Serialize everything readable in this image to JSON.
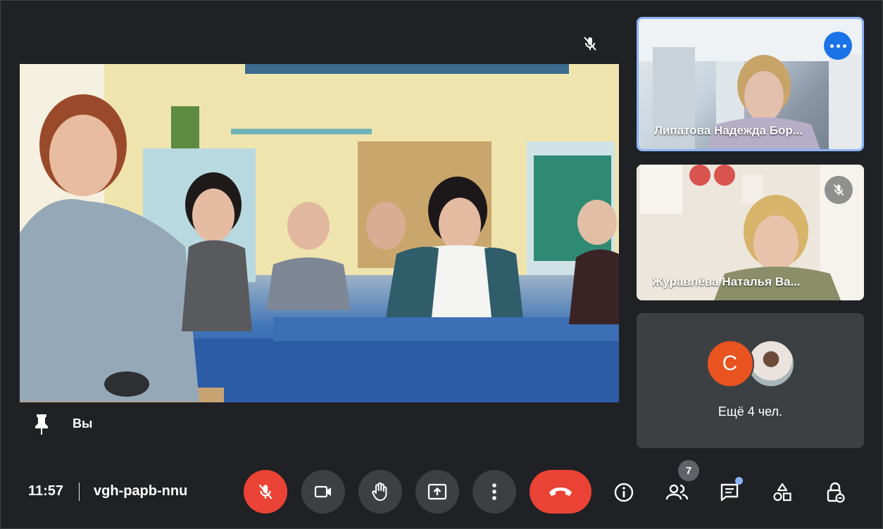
{
  "main": {
    "self_label": "Вы",
    "video": "classroom-self-view"
  },
  "participants": [
    {
      "name": "Липатова Надежда Бор...",
      "state": "active-speaker",
      "video": "woman-in-office"
    },
    {
      "name": "Журавлёва Наталья Ва...",
      "state": "muted",
      "video": "woman-in-classroom"
    }
  ],
  "more_tile": {
    "avatar_initial": "С",
    "label": "Ещё 4 чел."
  },
  "bottom_bar": {
    "time": "11:57",
    "meeting_code": "vgh-papb-nnu",
    "people_count": "7"
  },
  "icons": {
    "mic_off": "mic-off-icon",
    "camera": "videocam-icon",
    "raise_hand": "hand-icon",
    "present": "present-icon",
    "more": "more-vert-icon",
    "end_call": "call-end-icon",
    "info": "info-icon",
    "people": "people-icon",
    "chat": "chat-icon",
    "activities": "activities-icon",
    "host_controls": "host-controls-icon",
    "pin": "pin-icon"
  },
  "colors": {
    "background": "#202124",
    "tile": "#3c4043",
    "danger": "#ea4335",
    "accent": "#8ab4f8",
    "avatar": "#e8531f"
  }
}
